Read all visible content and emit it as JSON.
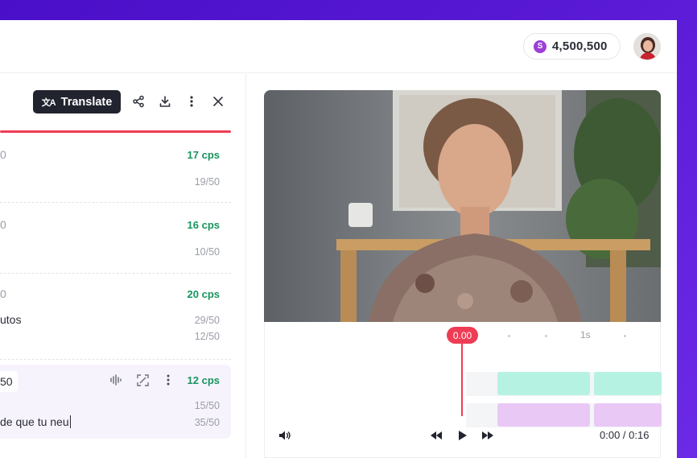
{
  "header": {
    "credits_symbol": "S",
    "credits_amount": "4,500,500"
  },
  "toolbar": {
    "translate_label": "Translate",
    "icons": [
      "translate-icon",
      "share-icon",
      "download-icon",
      "more-vertical-icon",
      "close-icon"
    ]
  },
  "segments": [
    {
      "time_fragment": "0",
      "cps": "17 cps",
      "text": "",
      "counts": [
        "19/50"
      ]
    },
    {
      "time_fragment": "0",
      "cps": "16 cps",
      "text": "",
      "counts": [
        "10/50"
      ]
    },
    {
      "time_fragment": "0",
      "cps": "20 cps",
      "text": "utos",
      "counts": [
        "29/50",
        "12/50"
      ]
    },
    {
      "time_fragment": "50",
      "cps": "12 cps",
      "text": "de que tu neu",
      "counts": [
        "15/50",
        "35/50"
      ],
      "active": true
    }
  ],
  "timeline": {
    "playhead_label": "0.00",
    "ruler_label": "1s",
    "time_readout": "0:00 / 0:16"
  },
  "colors": {
    "accent_red": "#ef3c55",
    "cps_green": "#18945c",
    "translate_button": "#21232e",
    "clip_teal": "#b6f2e2",
    "clip_pink": "#eac8f6",
    "credits_coin": "#9b3fd7"
  }
}
